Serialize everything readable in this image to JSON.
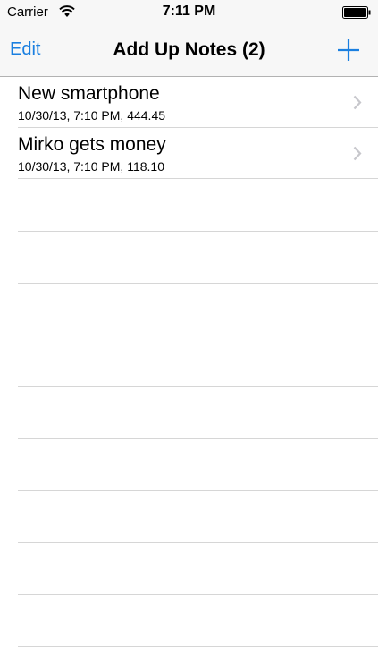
{
  "status_bar": {
    "carrier": "Carrier",
    "time": "7:11 PM"
  },
  "nav": {
    "edit_label": "Edit",
    "title": "Add Up Notes (2)",
    "add_icon": "plus-icon"
  },
  "notes": [
    {
      "title": "New smartphone",
      "subtitle": "10/30/13, 7:10 PM, 444.45"
    },
    {
      "title": "Mirko gets money",
      "subtitle": "10/30/13, 7:10 PM, 118.10"
    }
  ],
  "colors": {
    "accent": "#1a7fe0",
    "chevron": "#c7c7cc",
    "separator": "#d6d6d6"
  }
}
